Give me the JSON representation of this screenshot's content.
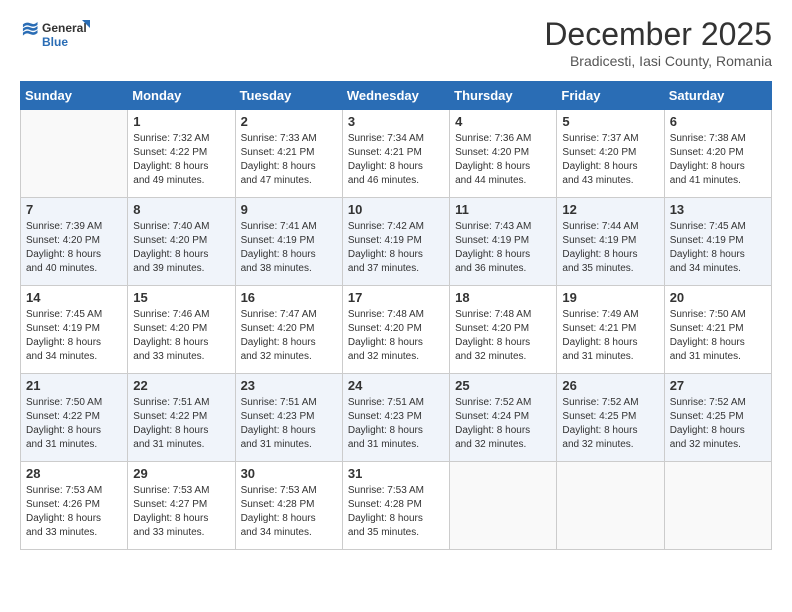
{
  "header": {
    "logo_general": "General",
    "logo_blue": "Blue",
    "month_title": "December 2025",
    "subtitle": "Bradicesti, Iasi County, Romania"
  },
  "days_of_week": [
    "Sunday",
    "Monday",
    "Tuesday",
    "Wednesday",
    "Thursday",
    "Friday",
    "Saturday"
  ],
  "weeks": [
    [
      {
        "day": "",
        "info": ""
      },
      {
        "day": "1",
        "info": "Sunrise: 7:32 AM\nSunset: 4:22 PM\nDaylight: 8 hours\nand 49 minutes."
      },
      {
        "day": "2",
        "info": "Sunrise: 7:33 AM\nSunset: 4:21 PM\nDaylight: 8 hours\nand 47 minutes."
      },
      {
        "day": "3",
        "info": "Sunrise: 7:34 AM\nSunset: 4:21 PM\nDaylight: 8 hours\nand 46 minutes."
      },
      {
        "day": "4",
        "info": "Sunrise: 7:36 AM\nSunset: 4:20 PM\nDaylight: 8 hours\nand 44 minutes."
      },
      {
        "day": "5",
        "info": "Sunrise: 7:37 AM\nSunset: 4:20 PM\nDaylight: 8 hours\nand 43 minutes."
      },
      {
        "day": "6",
        "info": "Sunrise: 7:38 AM\nSunset: 4:20 PM\nDaylight: 8 hours\nand 41 minutes."
      }
    ],
    [
      {
        "day": "7",
        "info": "Sunrise: 7:39 AM\nSunset: 4:20 PM\nDaylight: 8 hours\nand 40 minutes."
      },
      {
        "day": "8",
        "info": "Sunrise: 7:40 AM\nSunset: 4:20 PM\nDaylight: 8 hours\nand 39 minutes."
      },
      {
        "day": "9",
        "info": "Sunrise: 7:41 AM\nSunset: 4:19 PM\nDaylight: 8 hours\nand 38 minutes."
      },
      {
        "day": "10",
        "info": "Sunrise: 7:42 AM\nSunset: 4:19 PM\nDaylight: 8 hours\nand 37 minutes."
      },
      {
        "day": "11",
        "info": "Sunrise: 7:43 AM\nSunset: 4:19 PM\nDaylight: 8 hours\nand 36 minutes."
      },
      {
        "day": "12",
        "info": "Sunrise: 7:44 AM\nSunset: 4:19 PM\nDaylight: 8 hours\nand 35 minutes."
      },
      {
        "day": "13",
        "info": "Sunrise: 7:45 AM\nSunset: 4:19 PM\nDaylight: 8 hours\nand 34 minutes."
      }
    ],
    [
      {
        "day": "14",
        "info": "Sunrise: 7:45 AM\nSunset: 4:19 PM\nDaylight: 8 hours\nand 34 minutes."
      },
      {
        "day": "15",
        "info": "Sunrise: 7:46 AM\nSunset: 4:20 PM\nDaylight: 8 hours\nand 33 minutes."
      },
      {
        "day": "16",
        "info": "Sunrise: 7:47 AM\nSunset: 4:20 PM\nDaylight: 8 hours\nand 32 minutes."
      },
      {
        "day": "17",
        "info": "Sunrise: 7:48 AM\nSunset: 4:20 PM\nDaylight: 8 hours\nand 32 minutes."
      },
      {
        "day": "18",
        "info": "Sunrise: 7:48 AM\nSunset: 4:20 PM\nDaylight: 8 hours\nand 32 minutes."
      },
      {
        "day": "19",
        "info": "Sunrise: 7:49 AM\nSunset: 4:21 PM\nDaylight: 8 hours\nand 31 minutes."
      },
      {
        "day": "20",
        "info": "Sunrise: 7:50 AM\nSunset: 4:21 PM\nDaylight: 8 hours\nand 31 minutes."
      }
    ],
    [
      {
        "day": "21",
        "info": "Sunrise: 7:50 AM\nSunset: 4:22 PM\nDaylight: 8 hours\nand 31 minutes."
      },
      {
        "day": "22",
        "info": "Sunrise: 7:51 AM\nSunset: 4:22 PM\nDaylight: 8 hours\nand 31 minutes."
      },
      {
        "day": "23",
        "info": "Sunrise: 7:51 AM\nSunset: 4:23 PM\nDaylight: 8 hours\nand 31 minutes."
      },
      {
        "day": "24",
        "info": "Sunrise: 7:51 AM\nSunset: 4:23 PM\nDaylight: 8 hours\nand 31 minutes."
      },
      {
        "day": "25",
        "info": "Sunrise: 7:52 AM\nSunset: 4:24 PM\nDaylight: 8 hours\nand 32 minutes."
      },
      {
        "day": "26",
        "info": "Sunrise: 7:52 AM\nSunset: 4:25 PM\nDaylight: 8 hours\nand 32 minutes."
      },
      {
        "day": "27",
        "info": "Sunrise: 7:52 AM\nSunset: 4:25 PM\nDaylight: 8 hours\nand 32 minutes."
      }
    ],
    [
      {
        "day": "28",
        "info": "Sunrise: 7:53 AM\nSunset: 4:26 PM\nDaylight: 8 hours\nand 33 minutes."
      },
      {
        "day": "29",
        "info": "Sunrise: 7:53 AM\nSunset: 4:27 PM\nDaylight: 8 hours\nand 33 minutes."
      },
      {
        "day": "30",
        "info": "Sunrise: 7:53 AM\nSunset: 4:28 PM\nDaylight: 8 hours\nand 34 minutes."
      },
      {
        "day": "31",
        "info": "Sunrise: 7:53 AM\nSunset: 4:28 PM\nDaylight: 8 hours\nand 35 minutes."
      },
      {
        "day": "",
        "info": ""
      },
      {
        "day": "",
        "info": ""
      },
      {
        "day": "",
        "info": ""
      }
    ]
  ]
}
